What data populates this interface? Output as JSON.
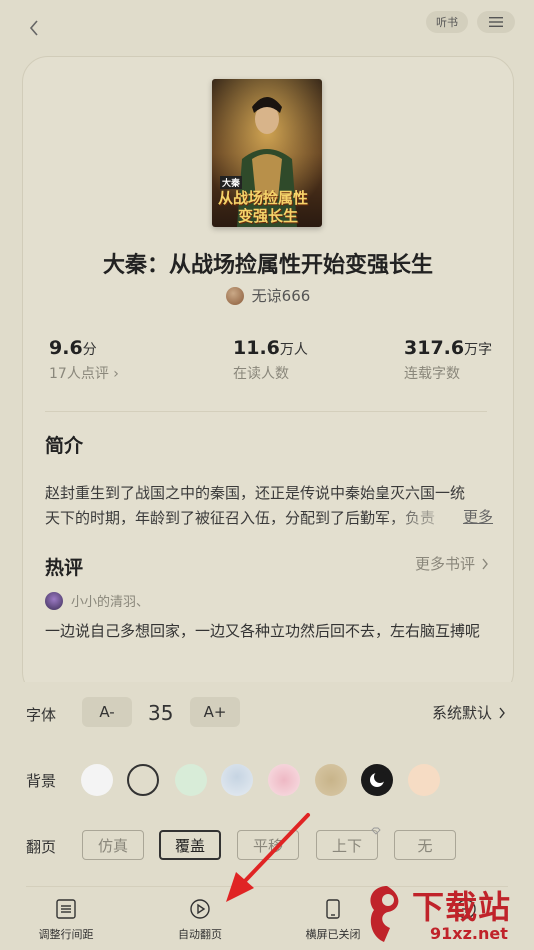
{
  "header": {
    "listen_label": "听书"
  },
  "book": {
    "title": "大秦：从战场捡属性开始变强长生",
    "author": "无谅666",
    "cover_text_line1": "从战场捡属性",
    "cover_text_line2": "变强长生",
    "cover_text_small": "大秦",
    "stats": [
      {
        "value": "9.6",
        "unit": "分",
        "sub": "17人点评 ›"
      },
      {
        "value": "11.6",
        "unit": "万人",
        "sub": "在读人数"
      },
      {
        "value": "317.6",
        "unit": "万字",
        "sub": "连载字数"
      }
    ]
  },
  "intro": {
    "title": "简介",
    "line1": "赵封重生到了战国之中的秦国，还正是传说中秦始皇灭六国一统",
    "line2": "天下的时期，年龄到了被征召入伍，分配到了后勤军，负责",
    "more": "更多"
  },
  "reviews": {
    "title": "热评",
    "more": "更多书评",
    "reviewer": "小小的清羽、",
    "text": "一边说自己多想回家，一边又各种立功然后回不去，左右脑互搏呢"
  },
  "settings": {
    "font_label": "字体",
    "font_decrease": "A-",
    "font_size": "35",
    "font_increase": "A+",
    "system_font": "系统默认",
    "bg_label": "背景",
    "backgrounds": [
      {
        "name": "white",
        "color": "#f4f4f4"
      },
      {
        "name": "current",
        "color": "#e0dccb"
      },
      {
        "name": "green",
        "color": "#d8ecd8"
      },
      {
        "name": "blue-pattern",
        "color": "#dfe6ee"
      },
      {
        "name": "pink-pattern",
        "color": "#f5d9de"
      },
      {
        "name": "paper",
        "color": "#d4c4a0"
      },
      {
        "name": "night",
        "color": "#1a1a1a"
      },
      {
        "name": "peach",
        "color": "#f6dcc4"
      }
    ],
    "page_label": "翻页",
    "page_modes": [
      "仿真",
      "覆盖",
      "平移",
      "上下",
      "无"
    ],
    "active_page_mode": "覆盖"
  },
  "toolbar": {
    "items": [
      {
        "label": "调整行间距",
        "icon": "line-spacing-icon"
      },
      {
        "label": "自动翻页",
        "icon": "auto-page-icon"
      },
      {
        "label": "横屏已关闭",
        "icon": "landscape-icon"
      },
      {
        "label": "",
        "icon": "more-icon"
      }
    ]
  },
  "watermark": {
    "text": "下载站",
    "url": "91xz.net"
  },
  "colors": {
    "background": "#e0dccb",
    "arrow": "#e02424"
  }
}
